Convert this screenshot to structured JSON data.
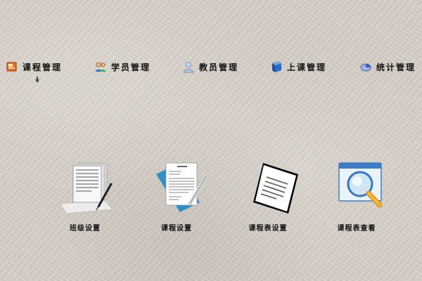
{
  "nav": {
    "items": [
      {
        "label": "课程管理",
        "icon": "course-book-icon"
      },
      {
        "label": "学员管理",
        "icon": "students-icon"
      },
      {
        "label": "教员管理",
        "icon": "teacher-icon"
      },
      {
        "label": "上课管理",
        "icon": "class-book-icon"
      },
      {
        "label": "统计管理",
        "icon": "statistics-icon"
      }
    ],
    "pointer_icon": "hand-pointer-icon"
  },
  "tiles": [
    {
      "label": "班级设置",
      "icon": "document-pen-icon"
    },
    {
      "label": "课程设置",
      "icon": "document-pencil-icon"
    },
    {
      "label": "课程表设置",
      "icon": "paper-sheet-icon"
    },
    {
      "label": "课程表查看",
      "icon": "magnifier-window-icon"
    }
  ]
}
